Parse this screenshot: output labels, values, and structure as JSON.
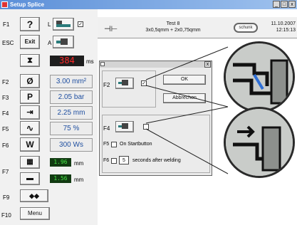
{
  "window": {
    "title": "Setup Splice",
    "min": "_",
    "max": "□",
    "close": "x"
  },
  "left": {
    "row1": {
      "key": "F1",
      "btn": "?",
      "side": "L"
    },
    "row2": {
      "key": "ESC",
      "btn": "Exit",
      "side": "A"
    },
    "timer": {
      "value": "384",
      "unit": "ms"
    },
    "params": [
      {
        "key": "F2",
        "icon": "Ø",
        "value": "3.00 mm²"
      },
      {
        "key": "F3",
        "icon": "P",
        "value": "2.05 bar"
      },
      {
        "key": "F4",
        "icon": "⇥",
        "value": "2.25 mm"
      },
      {
        "key": "F5",
        "icon": "∿",
        "value": "75 %"
      },
      {
        "key": "F6",
        "icon": "W",
        "value": "300 Ws"
      }
    ],
    "f7": {
      "key": "F7",
      "val1": "1.96",
      "unit1": "mm",
      "val2": "1.56",
      "unit2": "mm"
    },
    "f9": {
      "key": "F9",
      "btn": "◆◆"
    },
    "f10": {
      "key": "F10",
      "btn": "Menu"
    }
  },
  "header": {
    "test_name": "Test 8",
    "spec": "3x0,5qmm + 2x0,75qmm",
    "logo": "schunk",
    "date": "11.10.2007",
    "time": "12:15:13"
  },
  "dialog": {
    "close": "x",
    "f2_label": "F2",
    "ok": "OK",
    "cancel": "Abbrechen",
    "f4_label": "F4",
    "f5_label": "F5",
    "f5_text": "On Startbutton",
    "f6_label": "F6",
    "f6_value": "5",
    "f6_text": "seconds after welding"
  }
}
